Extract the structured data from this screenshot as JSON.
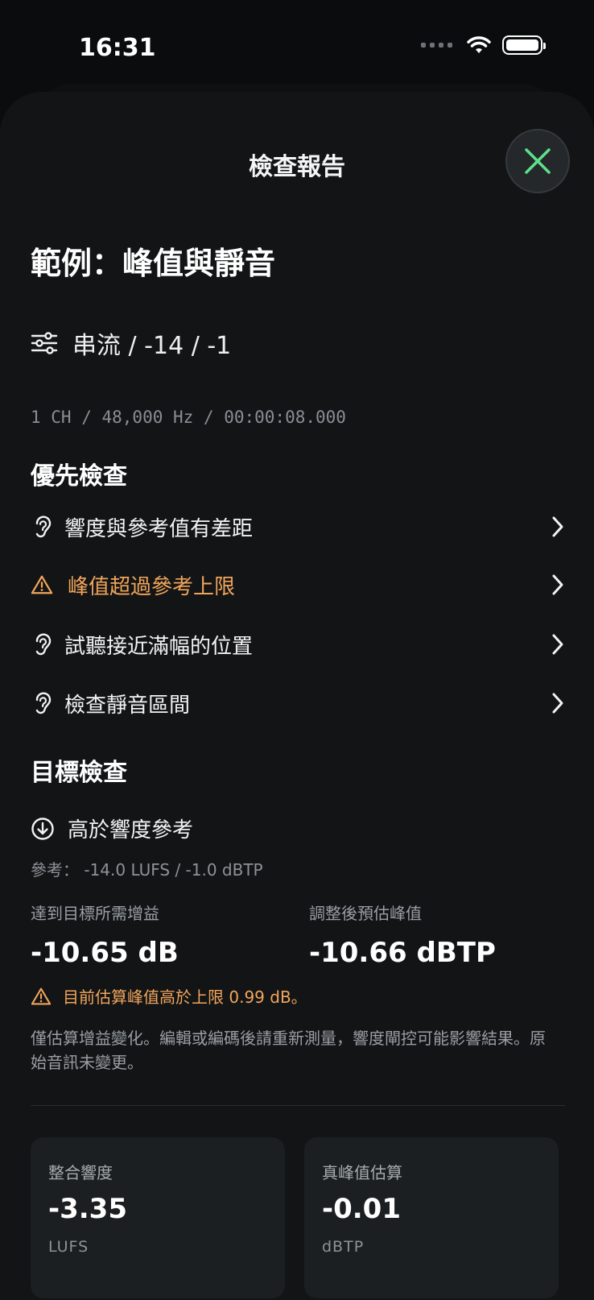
{
  "status": {
    "time": "16:31"
  },
  "sheet": {
    "title": "檢查報告"
  },
  "page": {
    "title": "範例：峰值與靜音",
    "preset": "串流 / -14 / -1",
    "meta": "1 CH / 48,000 Hz / 00:00:08.000"
  },
  "priority": {
    "heading": "優先檢查",
    "items": [
      {
        "label": "響度與參考值有差距",
        "icon": "ear-icon"
      },
      {
        "label": "峰值超過參考上限",
        "icon": "warning-icon",
        "color": "#f2a55a"
      },
      {
        "label": "試聽接近滿幅的位置",
        "icon": "ear-icon"
      },
      {
        "label": "檢查靜音區間",
        "icon": "ear-icon"
      }
    ]
  },
  "target": {
    "heading": "目標檢查",
    "status": "高於響度參考",
    "reference": "參考： -14.0 LUFS / -1.0 dBTP",
    "gain_caption": "達到目標所需增益",
    "gain_value": "-10.65 dB",
    "peak_caption": "調整後預估峰值",
    "peak_value": "-10.66 dBTP",
    "warning": "目前估算峰值高於上限 0.99 dB。",
    "note": "僅估算增益變化。編輯或編碼後請重新測量，響度閘控可能影響結果。原始音訊未變更。"
  },
  "cards": [
    {
      "caption": "整合響度",
      "value": "-3.35",
      "unit": "LUFS"
    },
    {
      "caption": "真峰值估算",
      "value": "-0.01",
      "unit": "dBTP"
    }
  ],
  "colors": {
    "accent": "#5ee08a",
    "warning": "#f2a55a",
    "background": "#121416"
  }
}
